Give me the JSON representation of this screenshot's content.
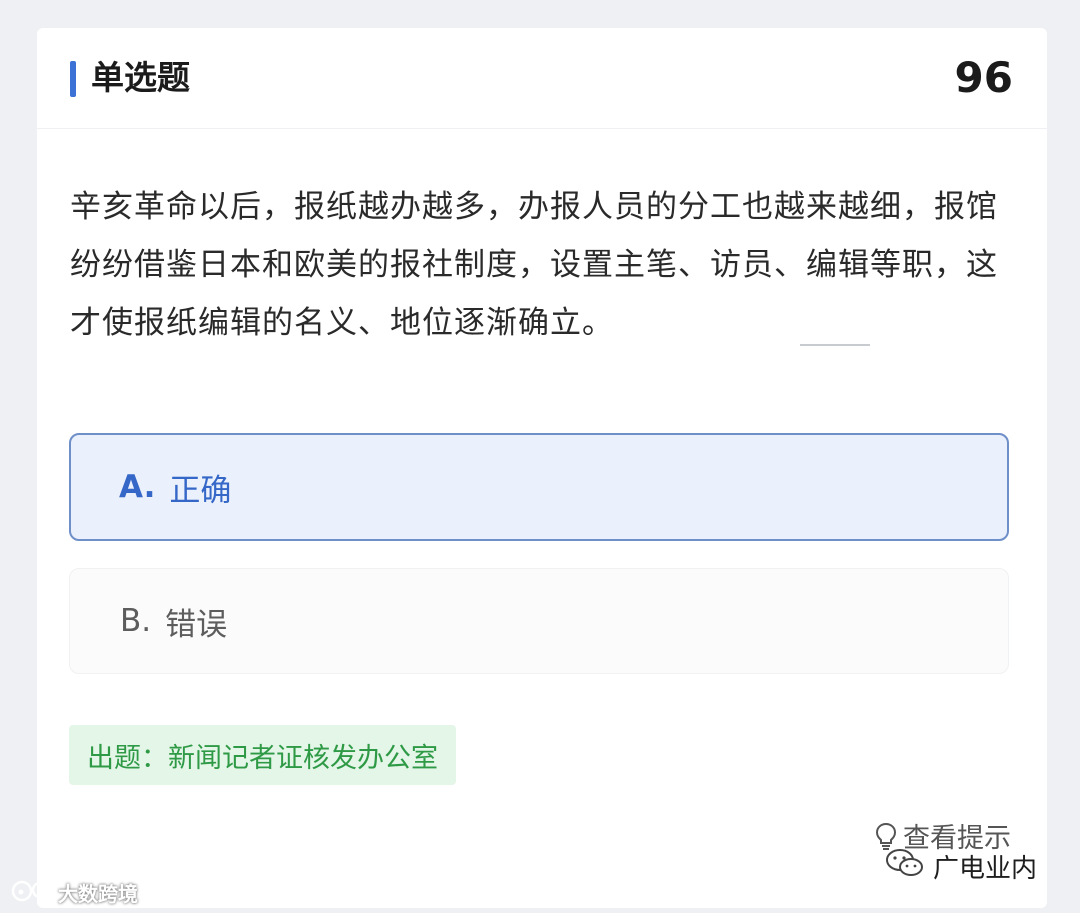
{
  "header": {
    "question_type": "单选题",
    "question_number": "96"
  },
  "question": {
    "text": "辛亥革命以后，报纸越办越多，办报人员的分工也越来越细，报馆纷纷借鉴日本和欧美的报社制度，设置主笔、访员、编辑等职，这才使报纸编辑的名义、地位逐渐确立。"
  },
  "options": [
    {
      "letter": "A.",
      "label": "正确",
      "selected": true
    },
    {
      "letter": "B.",
      "label": "错误",
      "selected": false
    }
  ],
  "source": {
    "text": "出题：新闻记者证核发办公室"
  },
  "hint": {
    "label": "查看提示",
    "icon": "lightbulb-icon"
  },
  "watermarks": {
    "right_label": "广电业内",
    "right_icon": "wechat-icon",
    "left_label": "大数跨境",
    "left_icon": "weibo-icon"
  },
  "colors": {
    "accent": "#3c72d6",
    "selected_bg": "#eaf0fc",
    "selected_border": "#6f8fc9",
    "source_bg": "#e4f6e8",
    "source_text": "#2f9a46"
  }
}
